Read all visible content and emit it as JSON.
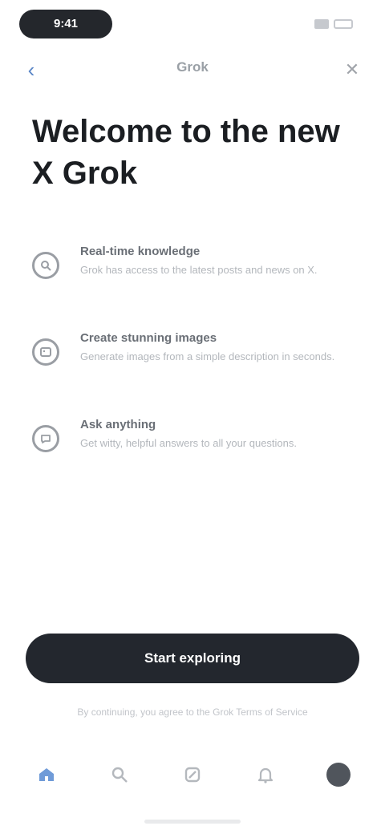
{
  "status_bar": {
    "time": "9:41"
  },
  "nav": {
    "back_icon": "‹",
    "title": "Grok",
    "close_icon": "✕"
  },
  "headline": "Welcome to the new X Grok",
  "features": [
    {
      "icon": "search-icon",
      "title": "Real-time knowledge",
      "description": "Grok has access to the latest posts and news on X."
    },
    {
      "icon": "image-icon",
      "title": "Create stunning images",
      "description": "Generate images from a simple description in seconds."
    },
    {
      "icon": "chat-icon",
      "title": "Ask anything",
      "description": "Get witty, helpful answers to all your questions."
    }
  ],
  "primary_button": "Start exploring",
  "footnote": "By continuing, you agree to the Grok Terms of Service",
  "tabs": [
    {
      "name": "home",
      "icon": "home-icon",
      "active": true
    },
    {
      "name": "search",
      "icon": "search-icon",
      "active": false
    },
    {
      "name": "grok",
      "icon": "grok-icon",
      "active": false
    },
    {
      "name": "notifications",
      "icon": "bell-icon",
      "active": false
    },
    {
      "name": "profile",
      "icon": "avatar-icon",
      "active": false
    }
  ],
  "colors": {
    "accent": "#6f9bd8",
    "button": "#23272e",
    "text_primary": "#1b1e22",
    "text_muted": "#b3b7bc"
  }
}
